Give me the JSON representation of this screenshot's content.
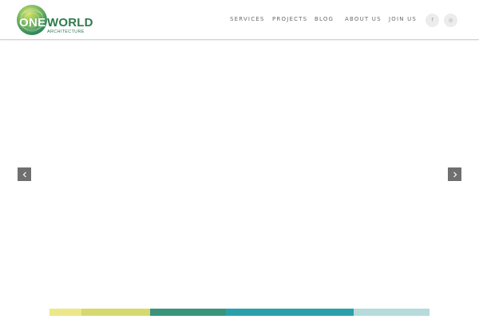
{
  "brand": {
    "word_one": "ONE",
    "word_world": "WORLD",
    "subtitle": "ARCHITECTURE"
  },
  "nav": {
    "items": [
      {
        "label": "SERVICES"
      },
      {
        "label": "PROJECTS"
      },
      {
        "label": "BLOG"
      },
      {
        "label": "ABOUT US"
      },
      {
        "label": "JOIN US"
      }
    ]
  },
  "social": {
    "facebook": "f",
    "instagram": "◎",
    "icons": [
      "facebook-icon",
      "instagram-icon"
    ]
  },
  "slider": {
    "prev_icon": "chevron-left-icon",
    "next_icon": "chevron-right-icon"
  },
  "colors": {
    "brand_green": "#2f7a4f",
    "logo_gradient": [
      "#c9dc5e",
      "#49a45f",
      "#1e7a5a"
    ],
    "palette": [
      "#ece889",
      "#d6d96e",
      "#3a947a",
      "#2aa0aa",
      "#b6dbdb"
    ],
    "arrow_bg": "#6f6f6f",
    "nav_text": "#6b6b6b"
  }
}
